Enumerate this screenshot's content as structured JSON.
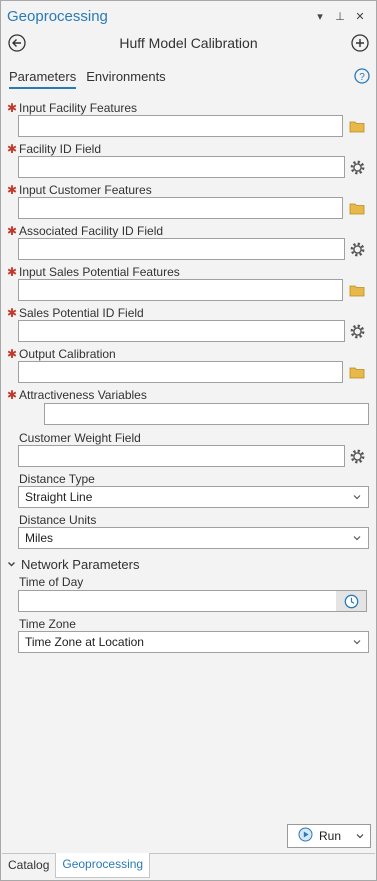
{
  "window": {
    "title": "Geoprocessing",
    "controls": [
      "▾",
      "⊥",
      "✕"
    ]
  },
  "tool": {
    "title": "Huff Model Calibration"
  },
  "tabs": [
    {
      "label": "Parameters",
      "active": true
    },
    {
      "label": "Environments",
      "active": false
    }
  ],
  "parameters": {
    "input_facility_features": {
      "label": "Input Facility Features",
      "value": "",
      "required": true
    },
    "facility_id_field": {
      "label": "Facility ID Field",
      "value": "",
      "required": true
    },
    "input_customer_features": {
      "label": "Input Customer Features",
      "value": "",
      "required": true
    },
    "associated_facility_id_field": {
      "label": "Associated Facility ID Field",
      "value": "",
      "required": true
    },
    "input_sales_potential_features": {
      "label": "Input Sales Potential Features",
      "value": "",
      "required": true
    },
    "sales_potential_id_field": {
      "label": "Sales Potential ID Field",
      "value": "",
      "required": true
    },
    "output_calibration": {
      "label": "Output Calibration",
      "value": "",
      "required": true
    },
    "attractiveness_variables": {
      "label": "Attractiveness Variables",
      "value": "",
      "required": true
    },
    "customer_weight_field": {
      "label": "Customer Weight Field",
      "value": "",
      "required": false
    },
    "distance_type": {
      "label": "Distance Type",
      "value": "Straight Line"
    },
    "distance_units": {
      "label": "Distance Units",
      "value": "Miles"
    }
  },
  "network_parameters": {
    "section_label": "Network Parameters",
    "time_of_day": {
      "label": "Time of Day",
      "value": ""
    },
    "time_zone": {
      "label": "Time Zone",
      "value": "Time Zone at Location"
    }
  },
  "run_button": {
    "label": "Run"
  },
  "bottom_tabs": [
    {
      "label": "Catalog",
      "active": false
    },
    {
      "label": "Geoprocessing",
      "active": true
    }
  ],
  "colors": {
    "accent": "#2a7ab8",
    "required": "#c0392b",
    "folder": "#e8b84a"
  },
  "icons": {
    "back": "back-arrow-icon",
    "add": "plus-circle-icon",
    "help": "help-icon",
    "folder": "folder-icon",
    "field_picker": "gear-icon",
    "time": "clock-icon",
    "run": "play-icon"
  }
}
